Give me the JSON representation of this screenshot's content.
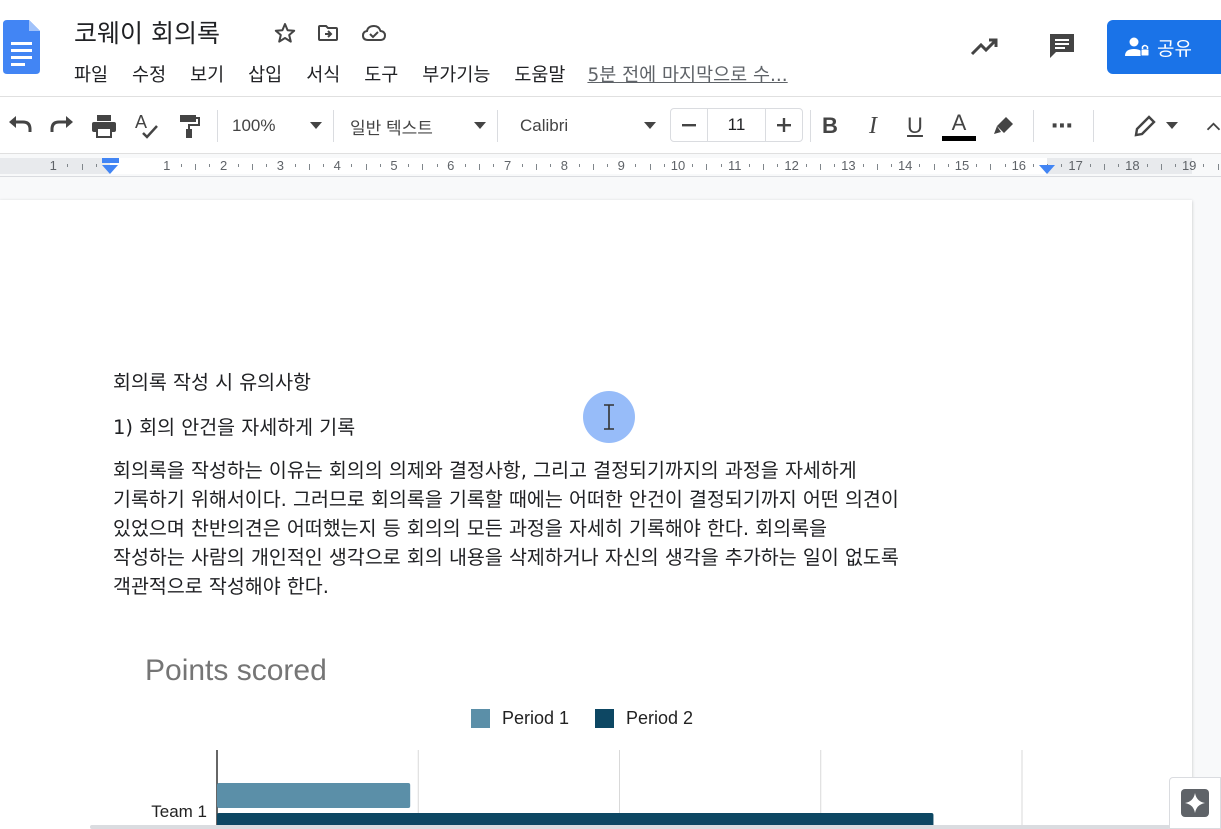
{
  "doc": {
    "title": "코웨이 회의록",
    "last_edit": "5분 전에 마지막으로 수..."
  },
  "menu": [
    "파일",
    "수정",
    "보기",
    "삽입",
    "서식",
    "도구",
    "부가기능",
    "도움말"
  ],
  "share": {
    "label": "공유"
  },
  "toolbar": {
    "zoom": "100%",
    "style": "일반 텍스트",
    "font": "Calibri",
    "font_size": "11",
    "bold": "B",
    "italic": "I",
    "underline": "U",
    "text_color": "A",
    "more": "⋯"
  },
  "ruler": {
    "numbers": [
      "1",
      "1",
      "2",
      "3",
      "4",
      "5",
      "6",
      "7",
      "8",
      "9",
      "10",
      "11",
      "12",
      "13",
      "14",
      "15",
      "16",
      "17",
      "18",
      "19"
    ]
  },
  "body": {
    "heading": "회의록 작성 시 유의사항",
    "point1": "1) 회의 안건을 자세하게 기록",
    "lines": [
      "회의록을 작성하는 이유는 회의의 의제와 결정사항, 그리고 결정되기까지의 과정을 자세하게",
      "기록하기 위해서이다. 그러므로 회의록을 기록할 때에는 어떠한 안건이 결정되기까지 어떤 의견이",
      "있었으며 찬반의견은 어떠했는지 등 회의의 모든 과정을 자세히 기록해야 한다. 회의록을",
      "작성하는 사람의 개인적인 생각으로 회의 내용을 삭제하거나 자신의 생각을 추가하는 일이 없도록",
      "객관적으로 작성해야 한다."
    ]
  },
  "chart_data": {
    "type": "bar",
    "orientation": "horizontal",
    "title": "Points scored",
    "categories": [
      "Team 1"
    ],
    "series": [
      {
        "name": "Period 1",
        "color": "#5b8fa8",
        "values": [
          48
        ]
      },
      {
        "name": "Period 2",
        "color": "#0d4763",
        "values": [
          178
        ]
      }
    ],
    "xlim": [
      0,
      200
    ],
    "grid": true,
    "legend_position": "top"
  },
  "colors": {
    "accent": "#1a73e8",
    "cursor_halo": "#4285f4"
  }
}
